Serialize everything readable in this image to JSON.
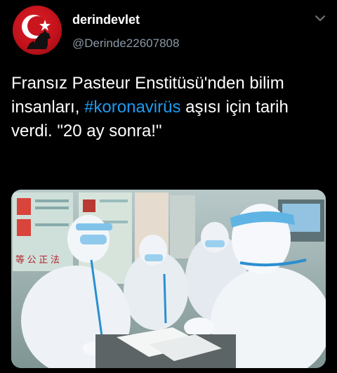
{
  "tweet": {
    "display_name": "derindevlet",
    "handle": "@Derinde22607808",
    "text_before": "Fransız Pasteur Enstitüsü'nden bilim insanları, ",
    "hashtag": "#koronavirüs",
    "text_after": " aşısı için tarih verdi. \"20 ay sonra!\"",
    "media_sign_text": "等 公 正 法"
  },
  "icons": {
    "avatar": "crescent-star-wolf-avatar",
    "menu": "chevron-down-icon"
  },
  "colors": {
    "background": "#000000",
    "hashtag": "#1d9bf0",
    "handle": "#8b98a5",
    "avatar_red": "#c2121b"
  }
}
